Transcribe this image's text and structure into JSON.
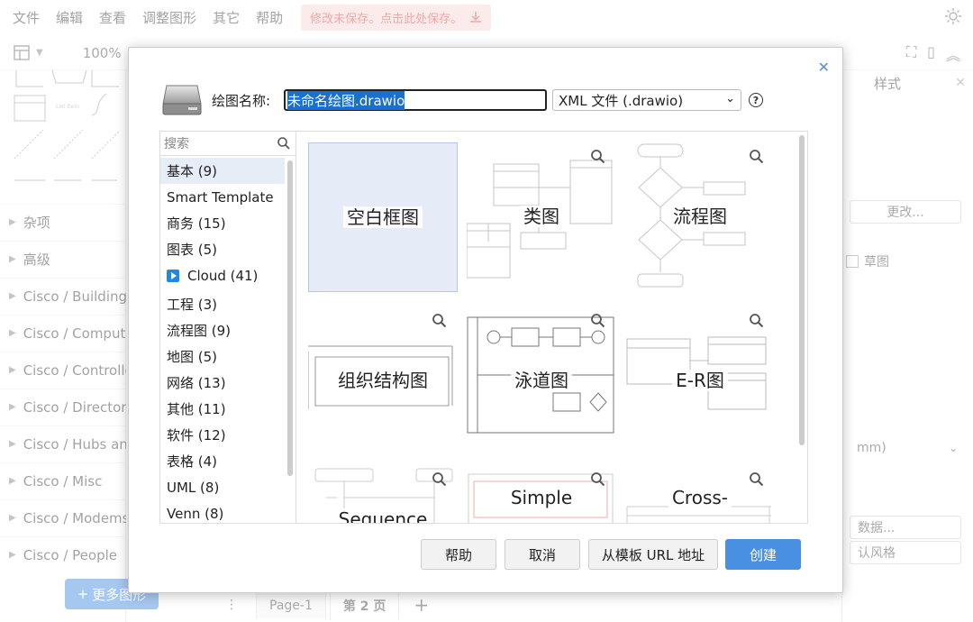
{
  "menubar": {
    "items": [
      "文件",
      "编辑",
      "查看",
      "调整图形",
      "其它",
      "帮助"
    ],
    "unsaved_banner": "修改未保存。点击此处保存。"
  },
  "toolbar": {
    "zoom": "100%"
  },
  "left_panel": {
    "libraries": [
      "杂项",
      "高级",
      "Cisco / Buildings",
      "Cisco / Computers",
      "Cisco / Controllers",
      "Cisco / Directors",
      "Cisco / Hubs and",
      "Cisco / Misc",
      "Cisco / Modems",
      "Cisco / People"
    ],
    "more_shapes": "更多图形"
  },
  "right_panel": {
    "title": "样式",
    "change_button": "更改...",
    "sketch_label": "草图",
    "unit_select": "mm)",
    "data_button": "数据...",
    "default_style": "认风格"
  },
  "pages": {
    "tabs": [
      "Page-1",
      "第 2 页"
    ]
  },
  "dialog": {
    "name_label": "绘图名称:",
    "name_value": "未命名绘图.drawio",
    "format": "XML 文件 (.drawio)",
    "help_symbol": "?",
    "search_placeholder": "搜索",
    "categories": [
      {
        "label": "基本 (9)"
      },
      {
        "label": "Smart Template"
      },
      {
        "label": "商务 (15)"
      },
      {
        "label": "图表 (5)"
      },
      {
        "label": "Cloud (41)"
      },
      {
        "label": "工程 (3)"
      },
      {
        "label": "流程图 (9)"
      },
      {
        "label": "地图 (5)"
      },
      {
        "label": "网络 (13)"
      },
      {
        "label": "其他 (11)"
      },
      {
        "label": "软件 (12)"
      },
      {
        "label": "表格 (4)"
      },
      {
        "label": "UML (8)"
      },
      {
        "label": "Venn (8)"
      }
    ],
    "templates": [
      "空白框图",
      "类图",
      "流程图",
      "组织结构图",
      "泳道图",
      "E-R图",
      "Sequence",
      "Simple",
      "Cross-"
    ],
    "buttons": {
      "help": "帮助",
      "cancel": "取消",
      "from_url": "从模板 URL 地址",
      "create": "创建"
    }
  },
  "colors": {
    "accent": "#4a90e2",
    "selection": "#1a6fd4",
    "selected_bg": "#e7edf7"
  }
}
